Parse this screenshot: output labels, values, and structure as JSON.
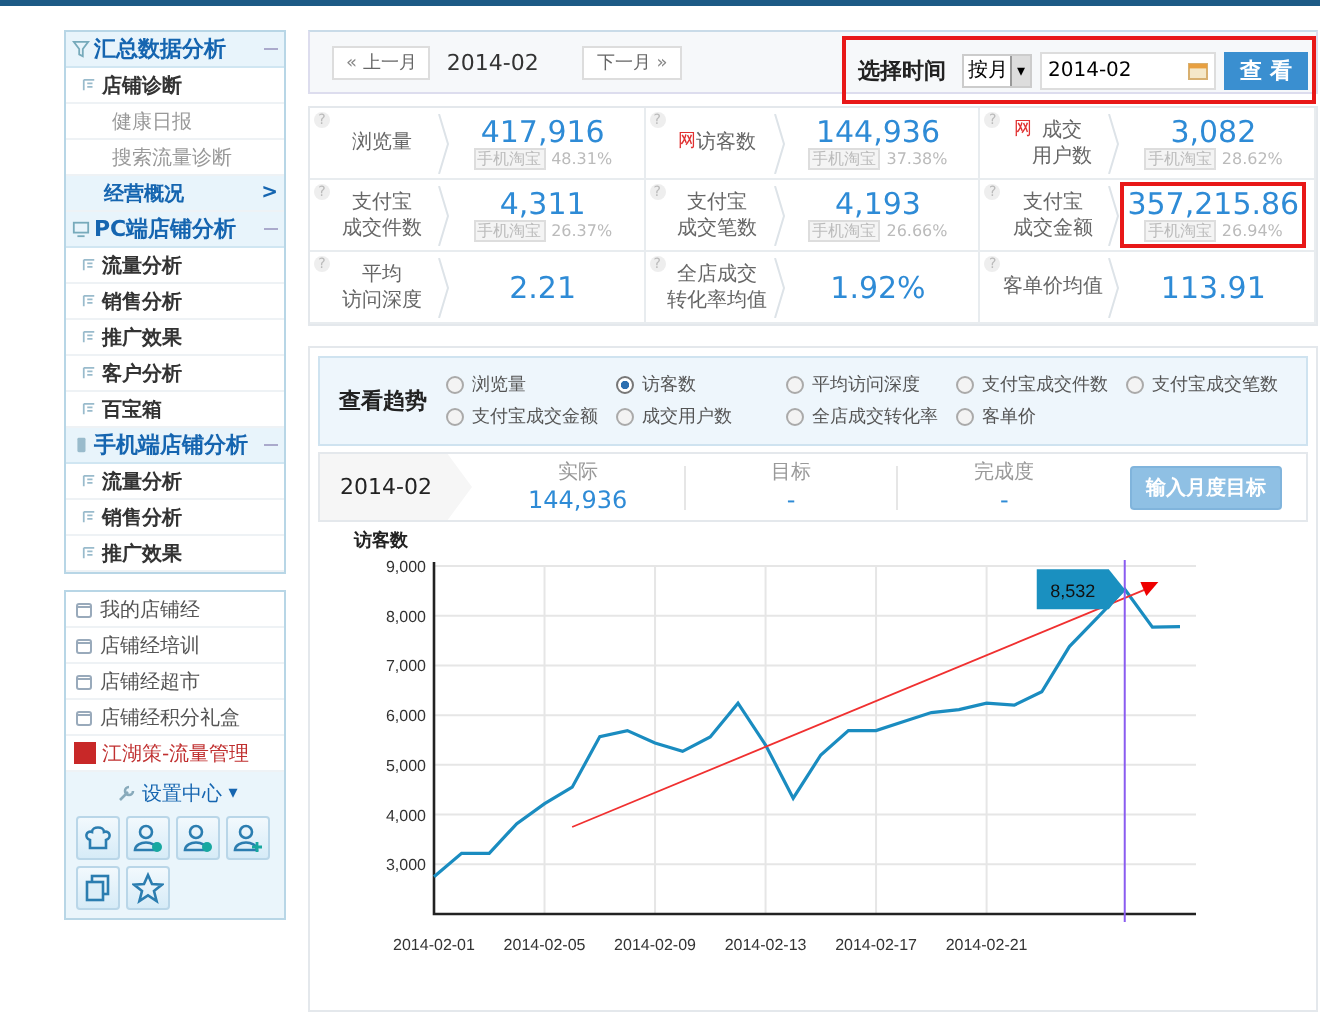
{
  "sidebar": {
    "sections": [
      {
        "title": "汇总数据分析",
        "expanded": true,
        "items": [
          {
            "label": "店铺诊断",
            "selected": false,
            "children": [
              {
                "label": "健康日报",
                "selected": false
              },
              {
                "label": "搜索流量诊断",
                "selected": false
              }
            ]
          },
          {
            "label": "经营概况",
            "selected": true,
            "arrow": ">"
          }
        ]
      },
      {
        "title": "PC端店铺分析",
        "expanded": true,
        "items": [
          {
            "label": "流量分析",
            "selected": false
          },
          {
            "label": "销售分析",
            "selected": false
          },
          {
            "label": "推广效果",
            "selected": false
          },
          {
            "label": "客户分析",
            "selected": false
          },
          {
            "label": "百宝箱",
            "selected": false
          }
        ]
      },
      {
        "title": "手机端店铺分析",
        "expanded": true,
        "items": [
          {
            "label": "流量分析",
            "selected": false
          },
          {
            "label": "销售分析",
            "selected": false
          },
          {
            "label": "推广效果",
            "selected": false
          }
        ]
      }
    ],
    "links": [
      {
        "label": "我的店铺经",
        "kind": "normal"
      },
      {
        "label": "店铺经培训",
        "kind": "normal"
      },
      {
        "label": "店铺经超市",
        "kind": "normal"
      },
      {
        "label": "店铺经积分礼盒",
        "kind": "normal"
      },
      {
        "label": "江湖策-流量管理",
        "kind": "promo"
      }
    ],
    "settings": {
      "label": "设置中心",
      "caret": "▾"
    }
  },
  "toolbar": {
    "prev": "上一月",
    "prev_icon": "«",
    "period": "2014-02",
    "next": "下一月",
    "next_icon": "»",
    "time_picker": {
      "label": "选择时间",
      "mode": "按月",
      "dropdown_icon": "▾",
      "value": "2014-02",
      "button": "查 看",
      "highlighted": true
    }
  },
  "stats": [
    {
      "help": "?",
      "label": [
        "浏览量"
      ],
      "value": "417,916",
      "source": "手机淘宝",
      "share": "48.31%",
      "highlighted": false
    },
    {
      "help": "?",
      "tag": "网",
      "label": [
        "访客数"
      ],
      "value": "144,936",
      "source": "手机淘宝",
      "share": "37.38%",
      "highlighted": false
    },
    {
      "help": "?",
      "tag": "网",
      "label": [
        "成交",
        "用户数"
      ],
      "value": "3,082",
      "source": "手机淘宝",
      "share": "28.62%",
      "highlighted": false
    },
    {
      "help": "?",
      "label": [
        "支付宝",
        "成交件数"
      ],
      "value": "4,311",
      "source": "手机淘宝",
      "share": "26.37%",
      "highlighted": false
    },
    {
      "help": "?",
      "label": [
        "支付宝",
        "成交笔数"
      ],
      "value": "4,193",
      "source": "手机淘宝",
      "share": "26.66%",
      "highlighted": false
    },
    {
      "help": "?",
      "label": [
        "支付宝",
        "成交金额"
      ],
      "value": "357,215.86",
      "source": "手机淘宝",
      "share": "26.94%",
      "highlighted": true
    },
    {
      "help": "?",
      "label": [
        "平均",
        "访问深度"
      ],
      "value": "2.21",
      "highlighted": false
    },
    {
      "help": "?",
      "label": [
        "全店成交",
        "转化率均值"
      ],
      "value": "1.92%",
      "highlighted": false
    },
    {
      "help": "?",
      "label": [
        "客单价均值"
      ],
      "value": "113.91",
      "highlighted": false
    }
  ],
  "trend": {
    "title": "查看趋势",
    "options": [
      {
        "label": "浏览量",
        "selected": false
      },
      {
        "label": "访客数",
        "selected": true
      },
      {
        "label": "平均访问深度",
        "selected": false
      },
      {
        "label": "支付宝成交件数",
        "selected": false
      },
      {
        "label": "支付宝成交笔数",
        "selected": false
      },
      {
        "label": "支付宝成交金额",
        "selected": false
      },
      {
        "label": "成交用户数",
        "selected": false
      },
      {
        "label": "全店成交转化率",
        "selected": false
      },
      {
        "label": "客单价",
        "selected": false
      }
    ],
    "target": {
      "period": "2014-02",
      "columns": [
        {
          "label": "实际",
          "value": "144,936"
        },
        {
          "label": "目标",
          "value": "-"
        },
        {
          "label": "完成度",
          "value": "-"
        }
      ],
      "button": "输入月度目标"
    },
    "tooltip": {
      "label": "8,532"
    },
    "chart_data": {
      "type": "line",
      "ylabel": "访客数",
      "grid": true,
      "categories": [
        "2014-02-01",
        null,
        null,
        null,
        "2014-02-05",
        null,
        null,
        null,
        "2014-02-09",
        null,
        null,
        null,
        "2014-02-13",
        null,
        null,
        null,
        "2014-02-17",
        null,
        null,
        null,
        "2014-02-21",
        null,
        null,
        null,
        null,
        null,
        null,
        null
      ],
      "series": [
        {
          "color": "#1a8cc0",
          "values": [
            2750,
            3220,
            3220,
            3820,
            4220,
            4550,
            5570,
            5690,
            5440,
            5270,
            5560,
            6240,
            5400,
            4330,
            5200,
            5690,
            5690,
            5870,
            6050,
            6110,
            6240,
            6200,
            6470,
            7380,
            7960,
            8532,
            7770,
            7780
          ]
        }
      ],
      "ylim": [
        2000,
        9000
      ],
      "yticks": [
        {
          "value": 3000,
          "label": "3,000"
        },
        {
          "value": 4000,
          "label": "4,000"
        },
        {
          "value": 5000,
          "label": "5,000"
        },
        {
          "value": 6000,
          "label": "6,000"
        },
        {
          "value": 7000,
          "label": "7,000"
        },
        {
          "value": 8000,
          "label": "8,000"
        },
        {
          "value": 9000,
          "label": "9,000"
        }
      ]
    }
  }
}
